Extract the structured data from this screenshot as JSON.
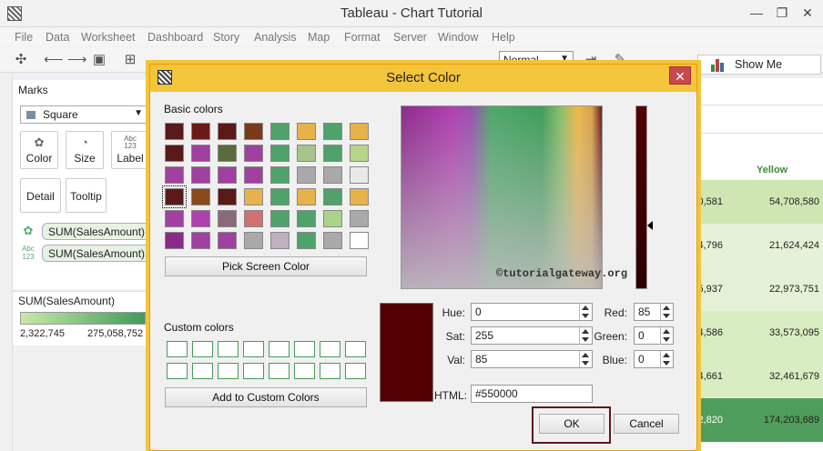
{
  "window": {
    "title": "Tableau - Chart Tutorial",
    "minimize": "—",
    "maximize": "❐",
    "close": "✕"
  },
  "menu": [
    "File",
    "Data",
    "Worksheet",
    "Dashboard",
    "Story",
    "Analysis",
    "Map",
    "Format",
    "Server",
    "Window",
    "Help"
  ],
  "toolbar": {
    "fit_value": "Normal",
    "show_me": "Show Me"
  },
  "marks": {
    "title": "Marks",
    "type": "Square",
    "buttons": [
      "Color",
      "Size",
      "Label",
      "Detail",
      "Tooltip"
    ],
    "label_icon": "Abc\n123",
    "pills": [
      "SUM(SalesAmount)",
      "SUM(SalesAmount)"
    ],
    "pill_icon_text": "Abc\n123"
  },
  "legend": {
    "title": "SUM(SalesAmount)",
    "min": "2,322,745",
    "max": "275,058,752"
  },
  "sheet": {
    "column_header": "Yellow",
    "rows": [
      {
        "left": "0,581",
        "right": "54,708,580"
      },
      {
        "left": "4,796",
        "right": "21,624,424"
      },
      {
        "left": "5,937",
        "right": "22,973,751"
      },
      {
        "left": "4,586",
        "right": "33,573,095"
      },
      {
        "left": "4,661",
        "right": "32,461,679"
      },
      {
        "left": "2,820",
        "right": "174,203,689"
      }
    ]
  },
  "dialog": {
    "title": "Select Color",
    "basic_colors_label": "Basic colors",
    "custom_colors_label": "Custom colors",
    "pick_screen_color": "Pick Screen Color",
    "add_custom": "Add to Custom Colors",
    "watermark": "©tutorialgateway.org",
    "fields": {
      "hue_label": "Hue:",
      "hue": "0",
      "sat_label": "Sat:",
      "sat": "255",
      "val_label": "Val:",
      "val": "85",
      "red_label": "Red:",
      "red": "85",
      "green_label": "Green:",
      "green": "0",
      "blue_label": "Blue:",
      "blue": "0",
      "html_label": "HTML:",
      "html": "#550000"
    },
    "ok": "OK",
    "cancel": "Cancel",
    "selected_color": "#550000",
    "basic_swatches": [
      "#5a1a1a",
      "#6b1a1a",
      "#5a1a1a",
      "#7a3a1a",
      "#4fa36a",
      "#e6b24a",
      "#4fa36a",
      "#e6b24a",
      "#5a1a1a",
      "#a040a0",
      "#5a6a3a",
      "#a040a0",
      "#4fa36a",
      "#a7c48a",
      "#4fa36a",
      "#b7d48a",
      "#a040a0",
      "#a040a0",
      "#a040a0",
      "#a040a0",
      "#4fa36a",
      "#a9a9a9",
      "#a9a9a9",
      "#e9e9e9",
      "#5a1a1a",
      "#8a4a1a",
      "#5a1a1a",
      "#e6b24a",
      "#4fa36a",
      "#e6b24a",
      "#4fa36a",
      "#e6b24a",
      "#a040a0",
      "#b040b0",
      "#8a6a7a",
      "#d07070",
      "#4fa36a",
      "#4fa36a",
      "#a9d48a",
      "#a9a9a9",
      "#8a2a8a",
      "#a040a0",
      "#a040a0",
      "#a9a9a9",
      "#c0b0c0",
      "#4fa36a",
      "#a9a9a9",
      "#ffffff"
    ]
  }
}
